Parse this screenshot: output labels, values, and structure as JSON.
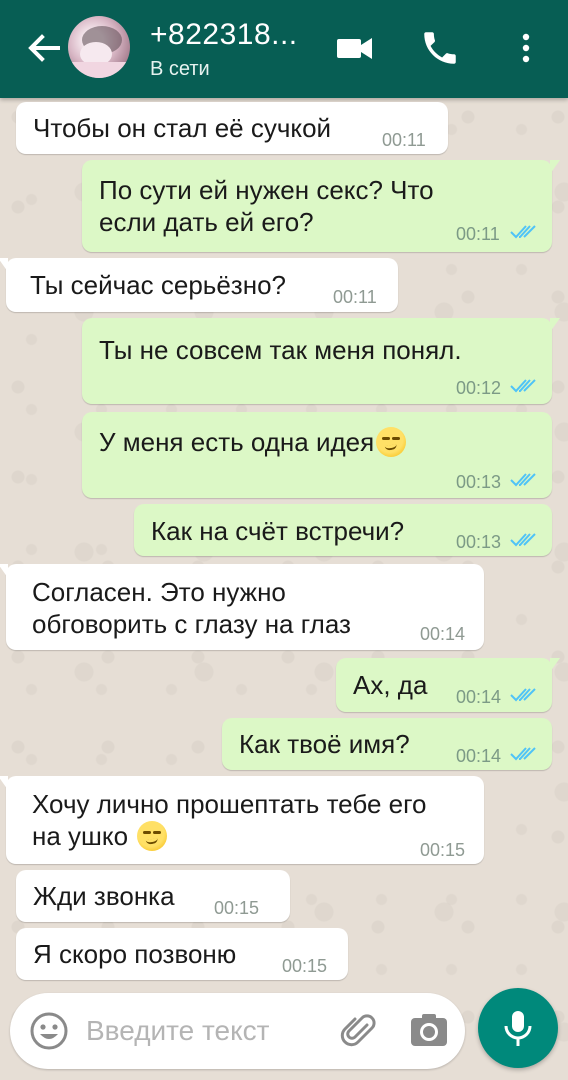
{
  "header": {
    "contact_name": "+822318...",
    "status": "В сети",
    "header_color": "#075e54"
  },
  "messages": [
    {
      "direction": "in",
      "text": "Чтобы он стал её сучкой",
      "time": "00:11"
    },
    {
      "direction": "out",
      "lines": [
        "По сути ей нужен секс? Что",
        "если дать ей его?"
      ],
      "time": "00:11",
      "read": true
    },
    {
      "direction": "in",
      "text": "Ты сейчас серьёзно?",
      "time": "00:11"
    },
    {
      "direction": "out",
      "text": "Ты не совсем так меня понял.",
      "time": "00:12",
      "read": true
    },
    {
      "direction": "out",
      "text": "У меня есть одна идея",
      "emoji": "smirking-face",
      "time": "00:13",
      "read": true
    },
    {
      "direction": "out",
      "text": "Как на счёт встречи?",
      "time": "00:13",
      "read": true
    },
    {
      "direction": "in",
      "lines": [
        "Согласен. Это нужно",
        "обговорить с глазу на глаз"
      ],
      "time": "00:14"
    },
    {
      "direction": "out",
      "text": "Ах, да",
      "time": "00:14",
      "read": true
    },
    {
      "direction": "out",
      "text": "Как твоё имя?",
      "time": "00:14",
      "read": true
    },
    {
      "direction": "in",
      "lines": [
        "Хочу лично прошептать тебе его",
        "на ушко"
      ],
      "emoji": "smirking-face",
      "time": "00:15"
    },
    {
      "direction": "in",
      "text": "Жди звонка",
      "time": "00:15"
    },
    {
      "direction": "in",
      "text": "Я скоро позвоню",
      "time": "00:15"
    }
  ],
  "composer": {
    "placeholder": "Введите текст"
  },
  "colors": {
    "incoming_bubble": "#ffffff",
    "outgoing_bubble": "#dcf8c6",
    "read_tick": "#4fc3f7",
    "mic_button": "#00897b"
  },
  "icons": [
    "back-arrow-icon",
    "video-call-icon",
    "phone-icon",
    "more-vert-icon",
    "emoji-icon",
    "attach-icon",
    "camera-icon",
    "mic-icon"
  ]
}
